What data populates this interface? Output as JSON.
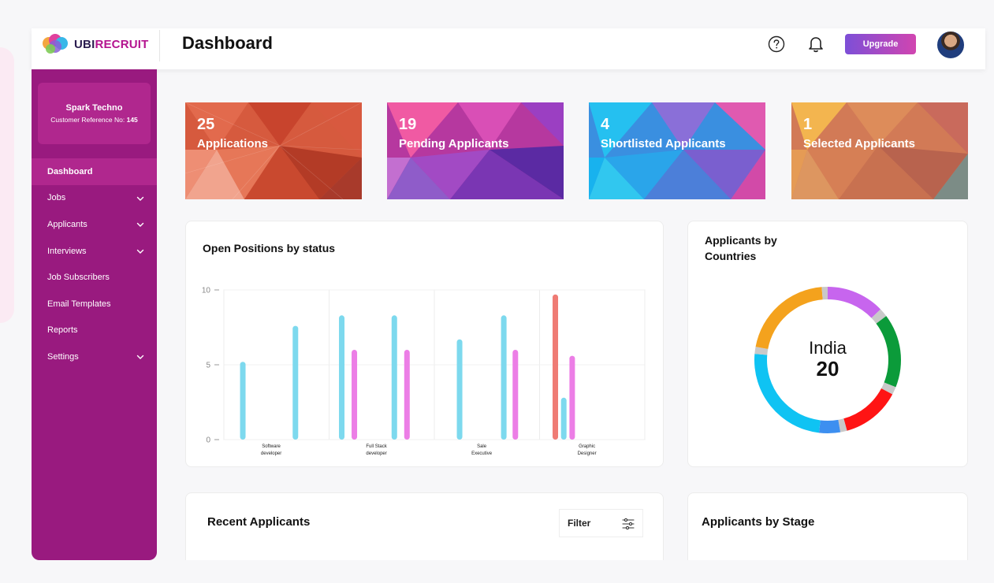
{
  "app": {
    "logo_ubi": "UBI",
    "logo_recruit": "RECRUIT",
    "page_title": "Dashboard",
    "upgrade_label": "Upgrade"
  },
  "company": {
    "name": "Spark Techno",
    "ref_label": "Customer Reference No:",
    "ref_number": "145"
  },
  "nav": [
    {
      "label": "Dashboard",
      "active": true,
      "chevron": false
    },
    {
      "label": "Jobs",
      "active": false,
      "chevron": true
    },
    {
      "label": "Applicants",
      "active": false,
      "chevron": true
    },
    {
      "label": "Interviews",
      "active": false,
      "chevron": true
    },
    {
      "label": "Job Subscribers",
      "active": false,
      "chevron": false
    },
    {
      "label": "Email Templates",
      "active": false,
      "chevron": false
    },
    {
      "label": "Reports",
      "active": false,
      "chevron": false
    },
    {
      "label": "Settings",
      "active": false,
      "chevron": true
    }
  ],
  "stats": [
    {
      "value": "25",
      "label": "Applications"
    },
    {
      "value": "19",
      "label": "Pending Applicants"
    },
    {
      "value": "4",
      "label": "Shortlisted Applicants"
    },
    {
      "value": "1",
      "label": "Selected Applicants"
    }
  ],
  "open_positions": {
    "title": "Open Positions by status"
  },
  "countries": {
    "title_line1": "Applicants by",
    "title_line2": "Countries",
    "center_country": "India",
    "center_count": "20"
  },
  "recent": {
    "title": "Recent Applicants",
    "filter_label": "Filter"
  },
  "stage": {
    "title": "Applicants by Stage"
  },
  "chart_data": [
    {
      "type": "bar",
      "title": "Open Positions by status",
      "categories": [
        "Software developer",
        "Full Stack developer",
        "Sale Executive",
        "Graphic Designer"
      ],
      "category_lines": [
        [
          "Software",
          "developer"
        ],
        [
          "Full Stack",
          "developer"
        ],
        [
          "Sale",
          "Executive"
        ],
        [
          "Graphic",
          "Designer"
        ]
      ],
      "ylim": [
        0,
        10
      ],
      "yticks": [
        0,
        5,
        10
      ],
      "grid": true,
      "bars": [
        {
          "category": 0,
          "value": 5.2,
          "color": "#7dd9ee"
        },
        {
          "category": 0,
          "value": 7.6,
          "color": "#7dd9ee"
        },
        {
          "category": 1,
          "value": 8.3,
          "color": "#7dd9ee"
        },
        {
          "category": 1,
          "value": 6.0,
          "color": "#ec7ee6"
        },
        {
          "category": 1,
          "value": 8.3,
          "color": "#7dd9ee"
        },
        {
          "category": 1,
          "value": 6.0,
          "color": "#ec7ee6"
        },
        {
          "category": 2,
          "value": 6.7,
          "color": "#7dd9ee"
        },
        {
          "category": 2,
          "value": 8.3,
          "color": "#7dd9ee"
        },
        {
          "category": 2,
          "value": 6.0,
          "color": "#ec7ee6"
        },
        {
          "category": 3,
          "value": 9.7,
          "color": "#ef7b74"
        },
        {
          "category": 3,
          "value": 2.8,
          "color": "#7dd9ee"
        },
        {
          "category": 3,
          "value": 5.6,
          "color": "#ec7ee6"
        }
      ]
    },
    {
      "type": "pie",
      "title": "Applicants by Countries",
      "center_label": "India",
      "center_value": 20,
      "slices": [
        {
          "value": 14.8,
          "color": "#c765ee"
        },
        {
          "value": 2.2,
          "color": "#c9c9c9"
        },
        {
          "value": 18.8,
          "color": "#0b9b3a"
        },
        {
          "value": 2.0,
          "color": "#c9c9c9"
        },
        {
          "value": 15.0,
          "color": "#ff1414"
        },
        {
          "value": 1.7,
          "color": "#c9c9c9"
        },
        {
          "value": 5.4,
          "color": "#3d8ff0"
        },
        {
          "value": 28.2,
          "color": "#0fc3f3"
        },
        {
          "value": 1.8,
          "color": "#c9c9c9"
        },
        {
          "value": 24.0,
          "color": "#f4a21d"
        },
        {
          "value": 1.5,
          "color": "#c9c9c9"
        }
      ]
    }
  ]
}
